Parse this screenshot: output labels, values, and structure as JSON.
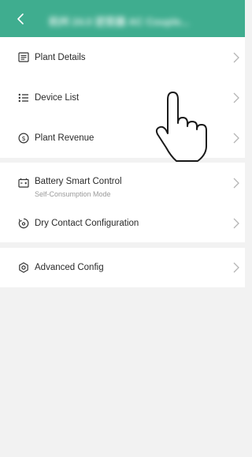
{
  "header": {
    "back_icon": "chevron-left-icon",
    "title": "杭州 24.0 逆变器 AC Couple..."
  },
  "menu_groups": [
    {
      "items": [
        {
          "label": "Plant Details",
          "icon": "document-list-icon"
        },
        {
          "label": "Device List",
          "icon": "bulleted-list-icon"
        },
        {
          "label": "Plant Revenue",
          "icon": "dollar-circle-icon"
        }
      ]
    },
    {
      "items": [
        {
          "label": "Battery Smart Control",
          "sublabel": "Self-Consumption Mode",
          "icon": "battery-icon"
        },
        {
          "label": "Dry Contact Configuration",
          "icon": "dry-contact-icon"
        }
      ]
    },
    {
      "items": [
        {
          "label": "Advanced Config",
          "icon": "gear-icon"
        }
      ]
    }
  ],
  "colors": {
    "header_bg": "#3fad8f",
    "page_bg": "#f2f2f2",
    "row_bg": "#ffffff",
    "text": "#2a2a2a",
    "subtext": "#9a9a9a",
    "chevron": "#b5b5b5"
  },
  "overlay": {
    "icon": "pointing-hand-icon"
  }
}
